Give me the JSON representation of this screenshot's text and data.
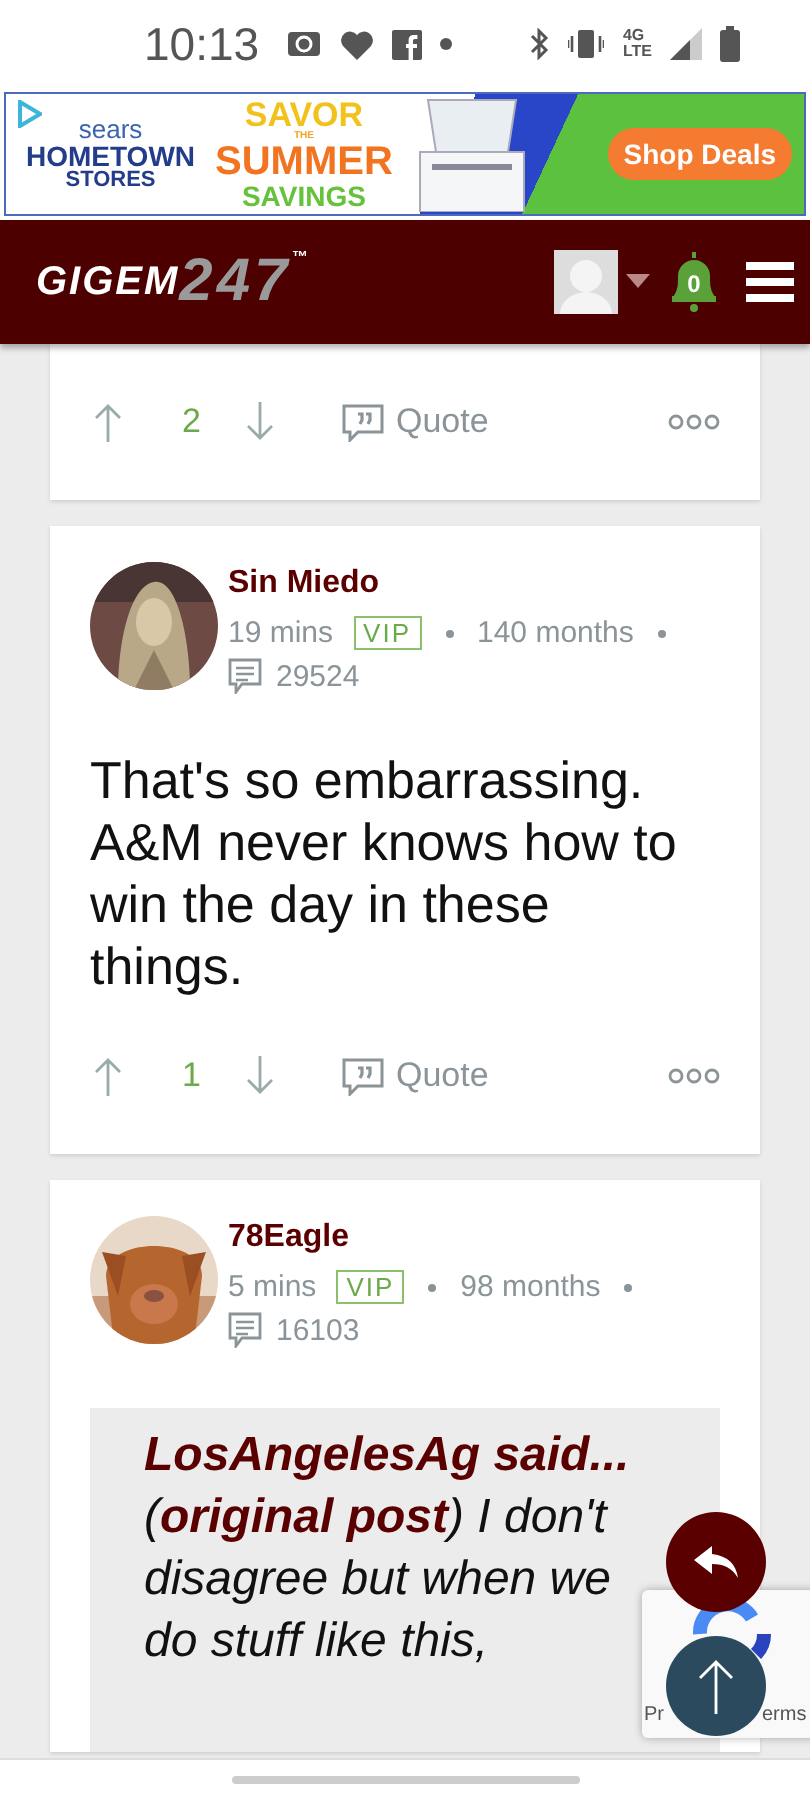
{
  "status_bar": {
    "time": "10:13",
    "network": "4G",
    "network_sub": "LTE"
  },
  "ad": {
    "brand_top": "sears",
    "brand_main": "HOMETOWN",
    "brand_sub": "STORES",
    "headline_top": "SAVOR",
    "headline_small": "THE",
    "headline_main": "SUMMER",
    "headline_bottom": "SAVINGS",
    "button": "Shop Deals"
  },
  "nav": {
    "logo_word": "GIGEM",
    "logo_number": "247",
    "logo_mark": "™",
    "notifications": "0"
  },
  "posts": [
    {
      "kind": "actions-only",
      "upvotes": "2",
      "quote_label": "Quote"
    },
    {
      "kind": "post",
      "author": "Sin Miedo",
      "time": "19 mins",
      "badge": "VIP",
      "tenure": "140 months",
      "post_count": "29524",
      "body": "That's so embarrassing. A&M never knows how to win the day in these things.",
      "upvotes": "1",
      "quote_label": "Quote"
    },
    {
      "kind": "quote-post",
      "author": "78Eagle",
      "time": "5 mins",
      "badge": "VIP",
      "tenure": "98 months",
      "post_count": "16103",
      "quote": {
        "author": "LosAngelesAg said...",
        "text": "(**original post**) I don't disagree but when we do stuff like this,"
      }
    }
  ],
  "recaptcha": {
    "left_text": "Pr",
    "right_text": "erms"
  }
}
